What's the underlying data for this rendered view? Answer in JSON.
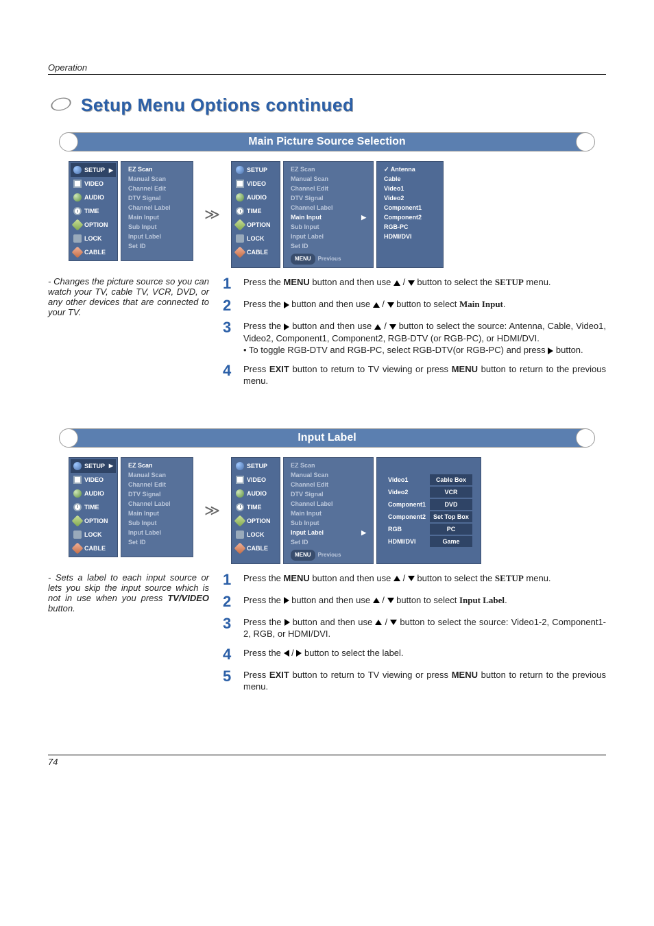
{
  "header": {
    "section": "Operation",
    "title": "Setup Menu Options continued"
  },
  "section1": {
    "banner": "Main Picture Source Selection",
    "desc": "- Changes the picture source so you can watch your TV, cable TV, VCR, DVD, or any other devices that are connected to your TV.",
    "sidebar": [
      "SETUP",
      "VIDEO",
      "AUDIO",
      "TIME",
      "OPTION",
      "LOCK",
      "CABLE"
    ],
    "list": [
      "EZ Scan",
      "Manual Scan",
      "Channel Edit",
      "DTV Signal",
      "Channel Label",
      "Main Input",
      "Sub Input",
      "Input Label",
      "Set ID"
    ],
    "highlighted": "Main Input",
    "third": [
      "Antenna",
      "Cable",
      "Video1",
      "Video2",
      "Component1",
      "Component2",
      "RGB-PC",
      "HDMI/DVI"
    ],
    "third_selected": "Antenna",
    "menu_btn": "MENU",
    "prev_txt": "Previous",
    "steps": {
      "s1a": "Press the ",
      "s1b": "MENU",
      "s1c": " button and then use ",
      "s1d": " button to select the ",
      "s1e": "SETUP",
      "s1f": " menu.",
      "s2a": "Press the ",
      "s2b": " button and then use ",
      "s2c": " button to select ",
      "s2d": "Main Input",
      "s2e": ".",
      "s3a": "Press the ",
      "s3b": " button and then use ",
      "s3c": " button to select the source: Antenna, Cable, Video1, Video2, Component1, Component2, RGB-DTV (or RGB-PC), or HDMI/DVI.",
      "s3d": "• To toggle RGB-DTV and RGB-PC, select RGB-DTV(or RGB-PC) and press ",
      "s3e": " button.",
      "s4a": "Press ",
      "s4b": "EXIT",
      "s4c": " button to return to TV viewing or press ",
      "s4d": "MENU",
      "s4e": " button to return to the previous menu."
    }
  },
  "section2": {
    "banner": "Input Label",
    "desc_a": "- Sets a label to each input source or lets you skip the input source which is not in use when you press ",
    "desc_b": "TV/VIDEO",
    "desc_c": " button.",
    "highlighted": "Input Label",
    "label_rows": [
      {
        "k": "Video1",
        "v": "Cable Box"
      },
      {
        "k": "Video2",
        "v": "VCR"
      },
      {
        "k": "Component1",
        "v": "DVD"
      },
      {
        "k": "Component2",
        "v": "Set Top Box"
      },
      {
        "k": "RGB",
        "v": "PC"
      },
      {
        "k": "HDMI/DVI",
        "v": "Game"
      }
    ],
    "steps": {
      "s1a": "Press the ",
      "s1b": "MENU",
      "s1c": " button and then use ",
      "s1d": " button to select the ",
      "s1e": "SETUP",
      "s1f": " menu.",
      "s2a": "Press the ",
      "s2b": " button and then use ",
      "s2c": " button to select  ",
      "s2d": "Input Label",
      "s2e": ".",
      "s3a": "Press the ",
      "s3b": " button and then use ",
      "s3c": " button to select the source: Video1-2, Component1-2, RGB, or HDMI/DVI.",
      "s4a": "Press the ",
      "s4b": " button to select the label.",
      "s5a": "Press ",
      "s5b": "EXIT",
      "s5c": " button to return to TV viewing or press ",
      "s5d": "MENU",
      "s5e": " button to return to the previous menu."
    }
  },
  "footer": {
    "page": "74"
  }
}
